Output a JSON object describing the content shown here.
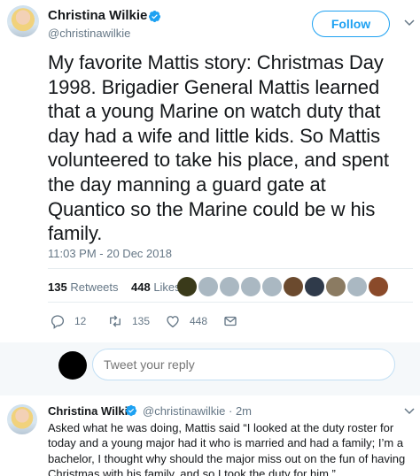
{
  "tweet": {
    "author_name": "Christina Wilkie",
    "author_handle": "@christinawilkie",
    "follow_label": "Follow",
    "text": "My favorite Mattis story: Christmas Day 1998. Brigadier General Mattis learned that a young Marine on watch duty that day had a wife and little kids. So Mattis volunteered to take his place, and spent the day manning a guard gate at Quantico so the Marine could be w his family.",
    "timestamp": "11:03 PM - 20 Dec 2018",
    "retweets_count": "135",
    "retweets_label": "Retweets",
    "likes_count": "448",
    "likes_label": "Likes",
    "liker_colors": [
      "#3a3a1a",
      "#aab8c2",
      "#aab8c2",
      "#aab8c2",
      "#aab8c2",
      "#6b4a2e",
      "#2f3a4a",
      "#8b7b62",
      "#aab8c2",
      "#8a4a2a"
    ]
  },
  "actions": {
    "reply_count": "12",
    "retweet_count": "135",
    "like_count": "448"
  },
  "reply_box": {
    "placeholder": "Tweet your reply"
  },
  "reply": {
    "author_name": "Christina Wilkie",
    "meta": "@christinawilkie · 2m",
    "text": "Asked what he was doing, Mattis said “I looked at the duty roster for today and a young major had it who is married and had a family; I’m a bachelor, I thought why should the major miss out on the fun of having Christmas with his family, and so I took the duty for him.”"
  },
  "colors": {
    "accent": "#1da1f2",
    "muted": "#657786",
    "divider": "#e6ecf0"
  }
}
